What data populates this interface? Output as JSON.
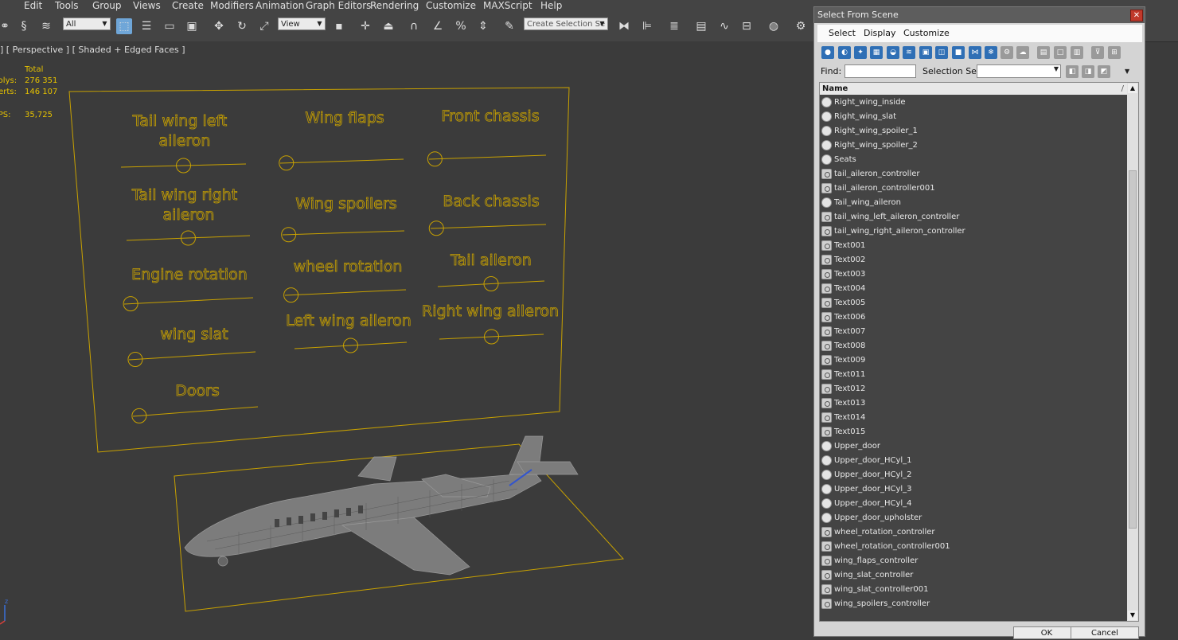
{
  "menubar": {
    "items": [
      "Edit",
      "Tools",
      "Group",
      "Views",
      "Create",
      "Modifiers",
      "Animation",
      "Graph Editors",
      "Rendering",
      "Customize",
      "MAXScript",
      "Help"
    ]
  },
  "toolbar": {
    "filter_select": "All",
    "refcoord_select": "View",
    "selection_set_placeholder": "Create Selection Se"
  },
  "viewport": {
    "label": "] [ Perspective ] [ Shaded + Edged Faces ]",
    "stats": {
      "header": "Total",
      "polys_label": "Polys:",
      "polys_value": "276 351",
      "verts_label": "Verts:",
      "verts_value": "146 107",
      "fps_label": "FPS:",
      "fps_value": "35,725"
    },
    "panel_labels": {
      "tail_wing_left_1": "Tail wing left",
      "tail_wing_left_2": "aileron",
      "wing_flaps": "Wing flaps",
      "front_chassis": "Front chassis",
      "tail_wing_right_1": "Tail wing right",
      "tail_wing_right_2": "aileron",
      "wing_spoilers": "Wing spoilers",
      "back_chassis": "Back chassis",
      "engine_rotation": "Engine rotation",
      "wheel_rotation": "wheel rotation",
      "tail_aileron": "Tail aileron",
      "wing_slat": "wing slat",
      "left_wing_aileron": "Left wing aileron",
      "right_wing_aileron": "Right wing aileron",
      "doors": "Doors"
    },
    "sliders": {
      "tail_wing_left": 0.5,
      "wing_flaps": 0.05,
      "front_chassis": 0.05,
      "tail_wing_right": 0.5,
      "wing_spoilers": 0.05,
      "back_chassis": 0.05,
      "engine_rotation": 0.05,
      "wheel_rotation": 0.05,
      "tail_aileron": 0.5,
      "wing_slat": 0.05,
      "left_wing_aileron": 0.5,
      "right_wing_aileron": 0.5,
      "doors": 0.05
    },
    "accent_color": "#c8a100"
  },
  "dialog": {
    "title": "Select From Scene",
    "close_glyph": "✕",
    "menu": [
      "Select",
      "Display",
      "Customize"
    ],
    "find_label": "Find:",
    "selection_set_label": "Selection Set:",
    "column_name": "Name",
    "sort_glyph": "/",
    "ok_label": "OK",
    "cancel_label": "Cancel",
    "items": [
      {
        "name": "Right_wing_inside",
        "type": "mesh"
      },
      {
        "name": "Right_wing_slat",
        "type": "mesh"
      },
      {
        "name": "Right_wing_spoiler_1",
        "type": "mesh"
      },
      {
        "name": "Right_wing_spoiler_2",
        "type": "mesh"
      },
      {
        "name": "Seats",
        "type": "mesh"
      },
      {
        "name": "tail_aileron_controller",
        "type": "shape"
      },
      {
        "name": "tail_aileron_controller001",
        "type": "shape"
      },
      {
        "name": "Tail_wing_aileron",
        "type": "mesh"
      },
      {
        "name": "tail_wing_left_aileron_controller",
        "type": "shape"
      },
      {
        "name": "tail_wing_right_aileron_controller",
        "type": "shape"
      },
      {
        "name": "Text001",
        "type": "shape"
      },
      {
        "name": "Text002",
        "type": "shape"
      },
      {
        "name": "Text003",
        "type": "shape"
      },
      {
        "name": "Text004",
        "type": "shape"
      },
      {
        "name": "Text005",
        "type": "shape"
      },
      {
        "name": "Text006",
        "type": "shape"
      },
      {
        "name": "Text007",
        "type": "shape"
      },
      {
        "name": "Text008",
        "type": "shape"
      },
      {
        "name": "Text009",
        "type": "shape"
      },
      {
        "name": "Text011",
        "type": "shape"
      },
      {
        "name": "Text012",
        "type": "shape"
      },
      {
        "name": "Text013",
        "type": "shape"
      },
      {
        "name": "Text014",
        "type": "shape"
      },
      {
        "name": "Text015",
        "type": "shape"
      },
      {
        "name": "Upper_door",
        "type": "mesh"
      },
      {
        "name": "Upper_door_HCyl_1",
        "type": "mesh"
      },
      {
        "name": "Upper_door_HCyl_2",
        "type": "mesh"
      },
      {
        "name": "Upper_door_HCyl_3",
        "type": "mesh"
      },
      {
        "name": "Upper_door_HCyl_4",
        "type": "mesh"
      },
      {
        "name": "Upper_door_upholster",
        "type": "mesh"
      },
      {
        "name": "wheel_rotation_controller",
        "type": "shape"
      },
      {
        "name": "wheel_rotation_controller001",
        "type": "shape"
      },
      {
        "name": "wing_flaps_controller",
        "type": "shape"
      },
      {
        "name": "wing_slat_controller",
        "type": "shape"
      },
      {
        "name": "wing_slat_controller001",
        "type": "shape"
      },
      {
        "name": "wing_spoilers_controller",
        "type": "shape"
      }
    ]
  }
}
